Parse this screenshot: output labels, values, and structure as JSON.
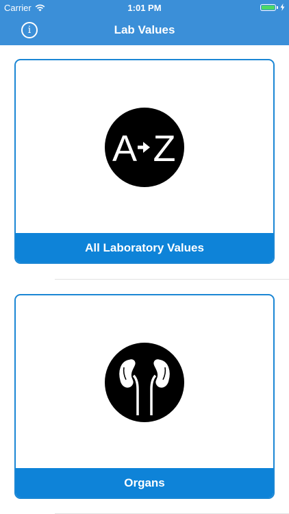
{
  "status_bar": {
    "carrier": "Carrier",
    "time": "1:01 PM",
    "battery_level": 1.0,
    "charging": true
  },
  "nav": {
    "title": "Lab Values",
    "info_icon": "info-circle-icon"
  },
  "colors": {
    "header_blue": "#3b8fd8",
    "card_blue": "#0e83d8",
    "battery_green": "#4cd964"
  },
  "cards": [
    {
      "label": "All Laboratory Values",
      "icon": "a-to-z-icon",
      "icon_text_left": "A",
      "icon_text_right": "Z"
    },
    {
      "label": "Organs",
      "icon": "kidneys-icon"
    }
  ]
}
